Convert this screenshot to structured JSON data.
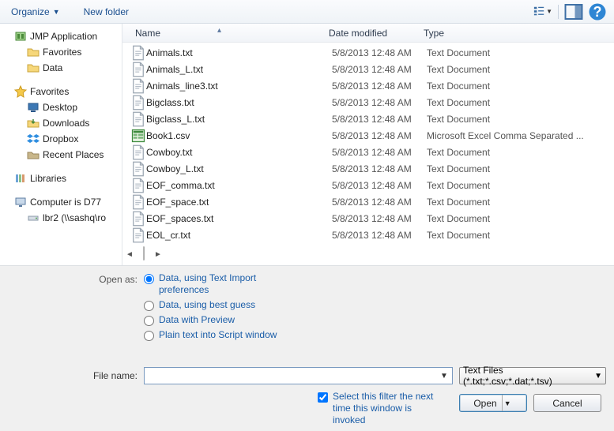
{
  "toolbar": {
    "organize": "Organize",
    "new_folder": "New folder"
  },
  "nav": {
    "jmp_app": "JMP Application",
    "favorites_sub": "Favorites",
    "data_sub": "Data",
    "favorites": "Favorites",
    "desktop": "Desktop",
    "downloads": "Downloads",
    "dropbox": "Dropbox",
    "recent": "Recent Places",
    "libraries": "Libraries",
    "computer": "Computer is D77",
    "network_share": "lbr2 (\\\\sashq\\ro"
  },
  "columns": {
    "name": "Name",
    "date": "Date modified",
    "type": "Type"
  },
  "types": {
    "text": "Text Document",
    "csv": "Microsoft Excel Comma Separated ..."
  },
  "files": [
    {
      "name": "Animals.txt",
      "date": "5/8/2013 12:48 AM",
      "type_key": "text",
      "icon": "txt"
    },
    {
      "name": "Animals_L.txt",
      "date": "5/8/2013 12:48 AM",
      "type_key": "text",
      "icon": "txt"
    },
    {
      "name": "Animals_line3.txt",
      "date": "5/8/2013 12:48 AM",
      "type_key": "text",
      "icon": "txt"
    },
    {
      "name": "Bigclass.txt",
      "date": "5/8/2013 12:48 AM",
      "type_key": "text",
      "icon": "txt"
    },
    {
      "name": "Bigclass_L.txt",
      "date": "5/8/2013 12:48 AM",
      "type_key": "text",
      "icon": "txt"
    },
    {
      "name": "Book1.csv",
      "date": "5/8/2013 12:48 AM",
      "type_key": "csv",
      "icon": "csv"
    },
    {
      "name": "Cowboy.txt",
      "date": "5/8/2013 12:48 AM",
      "type_key": "text",
      "icon": "txt"
    },
    {
      "name": "Cowboy_L.txt",
      "date": "5/8/2013 12:48 AM",
      "type_key": "text",
      "icon": "txt"
    },
    {
      "name": "EOF_comma.txt",
      "date": "5/8/2013 12:48 AM",
      "type_key": "text",
      "icon": "txt"
    },
    {
      "name": "EOF_space.txt",
      "date": "5/8/2013 12:48 AM",
      "type_key": "text",
      "icon": "txt"
    },
    {
      "name": "EOF_spaces.txt",
      "date": "5/8/2013 12:48 AM",
      "type_key": "text",
      "icon": "txt"
    },
    {
      "name": "EOL_cr.txt",
      "date": "5/8/2013 12:48 AM",
      "type_key": "text",
      "icon": "txt"
    }
  ],
  "open_as": {
    "label": "Open as:",
    "opts": [
      "Data, using Text Import preferences",
      "Data, using best guess",
      "Data with Preview",
      "Plain text into Script window"
    ],
    "selected_index": 0
  },
  "filename": {
    "label": "File name:",
    "value": ""
  },
  "filter": {
    "text": "Text Files (*.txt;*.csv;*.dat;*.tsv)"
  },
  "remember_filter": {
    "label": "Select this filter the next time this window is invoked",
    "checked": true
  },
  "buttons": {
    "open": "Open",
    "cancel": "Cancel"
  }
}
